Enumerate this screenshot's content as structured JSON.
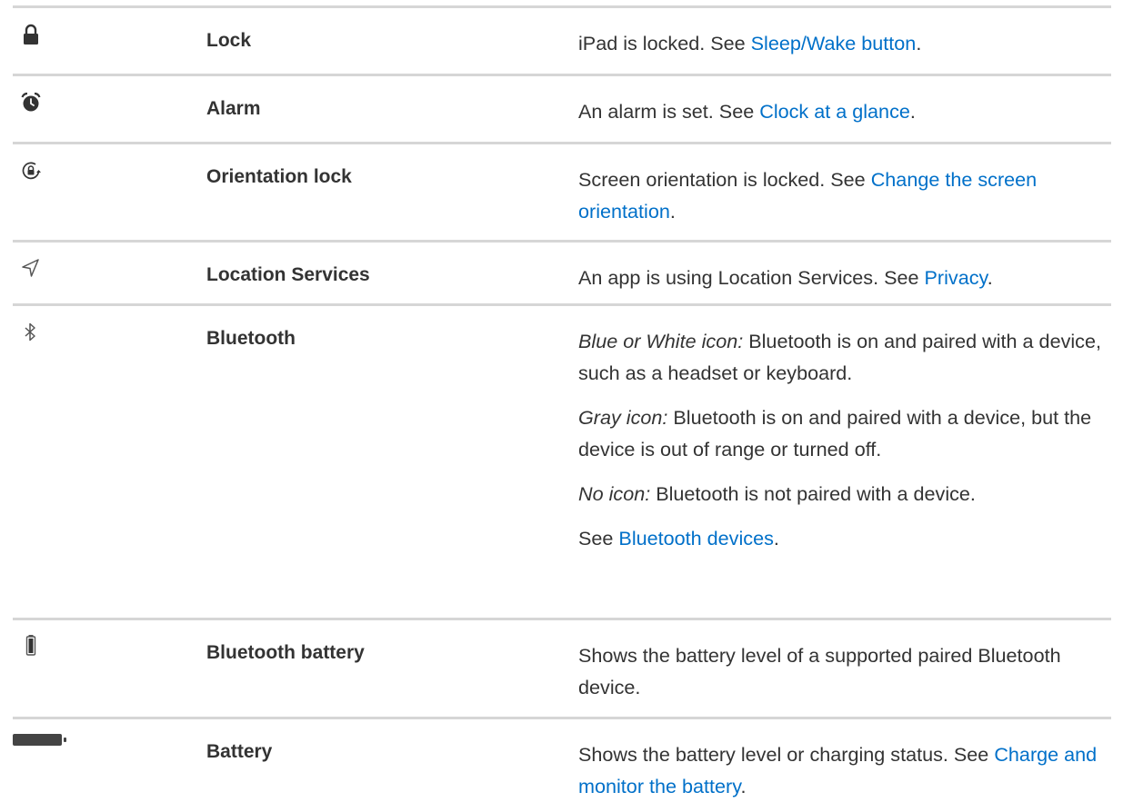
{
  "rows": [
    {
      "name": "Lock",
      "icon": "lock-icon",
      "desc": {
        "text": "iPad is locked. See ",
        "link": "Sleep/Wake button",
        "after": "."
      }
    },
    {
      "name": "Alarm",
      "icon": "alarm-clock-icon",
      "desc": {
        "text": "An alarm is set. See ",
        "link": "Clock at a glance",
        "after": "."
      }
    },
    {
      "name": "Orientation lock",
      "icon": "orientation-lock-icon",
      "desc": {
        "text": "Screen orientation is locked. See ",
        "link": "Change the screen orientation",
        "after": "."
      }
    },
    {
      "name": "Location Services",
      "icon": "location-arrow-icon",
      "desc": {
        "text": "An app is using Location Services. See ",
        "link": "Privacy",
        "after": "."
      }
    },
    {
      "name": "Bluetooth",
      "icon": "bluetooth-icon",
      "paragraphs": [
        {
          "em": "Blue or White icon:",
          "text": " Bluetooth is on and paired with a device, such as a headset or keyboard."
        },
        {
          "em": "Gray icon:",
          "text": " Bluetooth is on and paired with a device, but the device is out of range or turned off."
        },
        {
          "em": "No icon:",
          "text": " Bluetooth is not paired with a device."
        },
        {
          "text": "See ",
          "link": "Bluetooth devices",
          "after": "."
        }
      ]
    },
    {
      "name": "Bluetooth battery",
      "icon": "bluetooth-battery-icon",
      "desc": {
        "text": "Shows the battery level of a supported paired Bluetooth device."
      }
    },
    {
      "name": "Battery",
      "icon": "battery-icon",
      "desc": {
        "text": "Shows the battery level or charging status. See ",
        "link": "Charge and monitor the battery",
        "after": "."
      }
    }
  ]
}
